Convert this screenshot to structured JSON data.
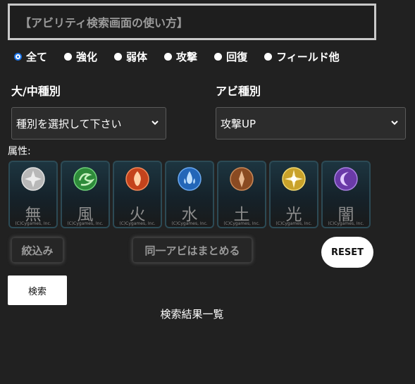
{
  "howto": {
    "title": "【アビリティ検索画面の使い方】"
  },
  "filters": {
    "options": [
      {
        "label": "全て",
        "checked": true
      },
      {
        "label": "強化",
        "checked": false
      },
      {
        "label": "弱体",
        "checked": false
      },
      {
        "label": "攻撃",
        "checked": false
      },
      {
        "label": "回復",
        "checked": false
      },
      {
        "label": "フィールド他",
        "checked": false
      }
    ]
  },
  "category": {
    "label": "大/中種別",
    "value": "種別を選択して下さい"
  },
  "abi_type": {
    "label": "アビ種別",
    "value": "攻撃UP"
  },
  "attributes": {
    "label": "属性:",
    "items": [
      {
        "kanji": "無",
        "color": "#b8b8b8",
        "icon": "none-element-icon",
        "credit": "(C)Cygames, Inc."
      },
      {
        "kanji": "風",
        "color": "#2e8b3a",
        "icon": "wind-element-icon",
        "credit": "(C)Cygames, Inc."
      },
      {
        "kanji": "火",
        "color": "#c4431c",
        "icon": "fire-element-icon",
        "credit": "(C)Cygames, Inc."
      },
      {
        "kanji": "水",
        "color": "#2366b8",
        "icon": "water-element-icon",
        "credit": "(C)Cygames, Inc."
      },
      {
        "kanji": "土",
        "color": "#8a4a22",
        "icon": "earth-element-icon",
        "credit": "(C)Cygames, Inc."
      },
      {
        "kanji": "光",
        "color": "#c9a22a",
        "icon": "light-element-icon",
        "credit": "(C)Cygames, Inc."
      },
      {
        "kanji": "闇",
        "color": "#6a3aa8",
        "icon": "dark-element-icon",
        "credit": "(C)Cygames, Inc."
      }
    ]
  },
  "buttons": {
    "narrow": "絞込み",
    "group": "同一アビはまとめる",
    "reset": "RESET",
    "search": "検索"
  },
  "results": {
    "title": "検索結果一覧"
  }
}
